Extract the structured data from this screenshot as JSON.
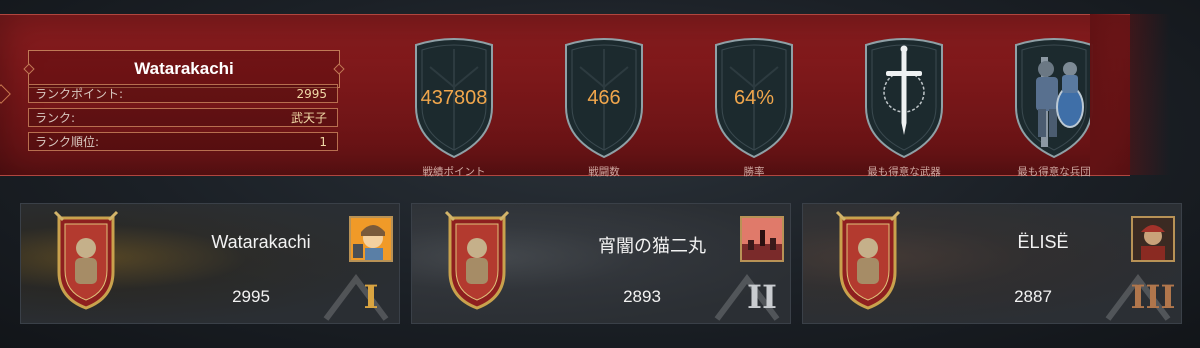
{
  "player": {
    "name": "Watarakachi",
    "stats": [
      {
        "label": "ランクポイント:",
        "value": "2995"
      },
      {
        "label": "ランク:",
        "value": "武天子"
      },
      {
        "label": "ランク順位:",
        "value": "1"
      }
    ]
  },
  "summary": [
    {
      "value": "437808",
      "label": "戦績ポイント"
    },
    {
      "value": "466",
      "label": "戦闘数"
    },
    {
      "value": "64%",
      "label": "勝率"
    },
    {
      "value": "",
      "label": "最も得意な武器",
      "icon": "sword-icon"
    },
    {
      "value": "",
      "label": "最も得意な兵団",
      "icon": "knight-unit-icon"
    }
  ],
  "leaderboard": [
    {
      "name": "Watarakachi",
      "score": "2995",
      "rank_numeral": "I",
      "tier": "gold"
    },
    {
      "name": "宵闇の猫二丸",
      "score": "2893",
      "rank_numeral": "II",
      "tier": "silver"
    },
    {
      "name": "ËLISË",
      "score": "2887",
      "rank_numeral": "III",
      "tier": "bronze"
    }
  ],
  "colors": {
    "banner_red": "#7a1719",
    "accent_orange": "#f0a64c",
    "gold": "#d9a441",
    "silver": "#c9ccd0",
    "bronze": "#b0764c"
  }
}
